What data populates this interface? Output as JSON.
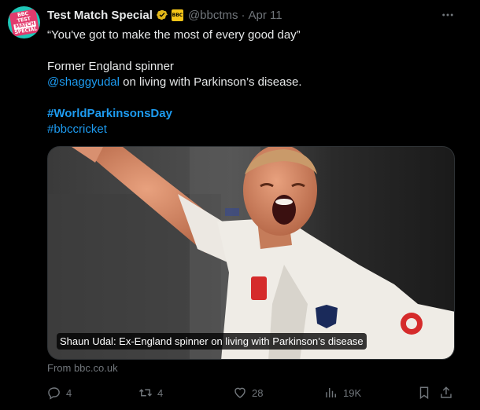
{
  "tweet": {
    "author_name": "Test Match Special",
    "handle": "@bbctms",
    "separator": "·",
    "date": "Apr 11",
    "avatar_text": [
      "BBC",
      "TEST",
      "MATCH",
      "SPECIAL"
    ],
    "org_badge": "BBC",
    "line1": "“You've got to make the most of every good day”",
    "line2": "Former England spinner",
    "mention": "@shaggyudal",
    "line3_rest": " on living with Parkinson’s disease.",
    "hashtag1": "#WorldParkinsonsDay",
    "hashtag2": "#bbccricket"
  },
  "card": {
    "caption": "Shaun Udal: Ex-England spinner on living with Parkinson’s disease",
    "source": "From bbc.co.uk"
  },
  "actions": {
    "replies": "4",
    "reposts": "4",
    "likes": "28",
    "views": "19K"
  },
  "icons": {
    "verified": "verified-badge-icon",
    "more": "more-dots-icon",
    "reply": "reply-icon",
    "repost": "repost-icon",
    "like": "heart-icon",
    "views": "views-icon",
    "bookmark": "bookmark-icon",
    "share": "share-icon"
  },
  "colors": {
    "accent": "#1d9bf0",
    "verified_gold": "#e2b719",
    "muted": "#71767b",
    "text": "#e7e9ea",
    "avatar_bg": "#1fc6b7"
  }
}
